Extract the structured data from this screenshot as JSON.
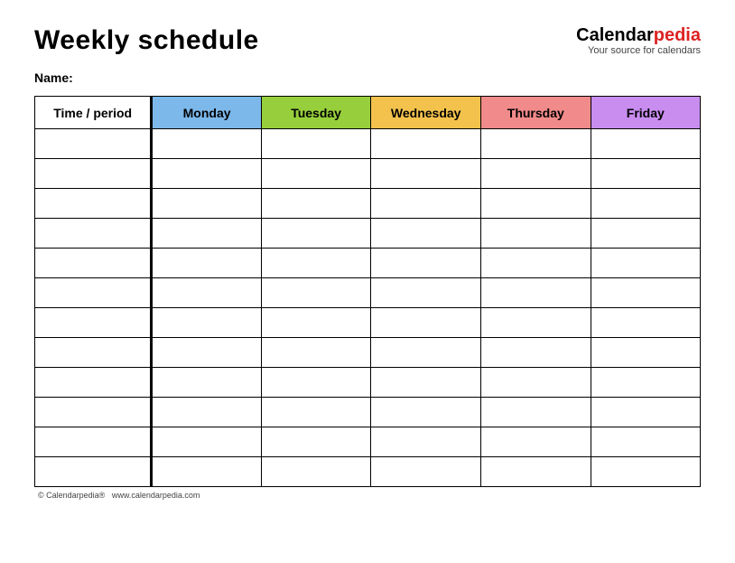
{
  "title": "Weekly schedule",
  "name_label": "Name:",
  "branding": {
    "part1": "Calendar",
    "part2": "pedia",
    "tagline": "Your source for calendars"
  },
  "columns": {
    "time_header": "Time / period",
    "days": [
      "Monday",
      "Tuesday",
      "Wednesday",
      "Thursday",
      "Friday"
    ],
    "colors": [
      "#7cb8ea",
      "#97cf3c",
      "#f3c24d",
      "#f18a8a",
      "#c98df0"
    ]
  },
  "rows": 12,
  "footer": {
    "copyright": "© Calendarpedia®",
    "url": "www.calendarpedia.com"
  }
}
